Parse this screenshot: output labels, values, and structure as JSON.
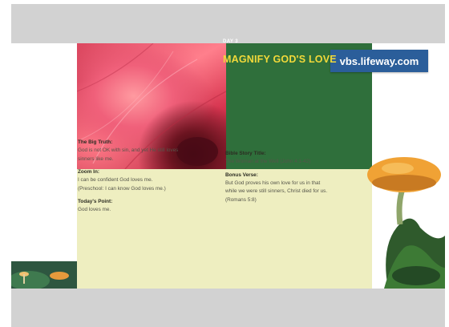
{
  "banner": {
    "url": "vbs.lifeway.com"
  },
  "slide": {
    "day_label": "DAY 3",
    "theme_title": "MAGNIFY GOD'S LOVE",
    "big_truth": {
      "heading": "The Big Truth:",
      "lines": [
        "God is not OK with sin, and yet He still loves",
        "sinners like me."
      ]
    },
    "zoom_in": {
      "heading": "Zoom In:",
      "lines": [
        "I can be confident God loves me.",
        "(Preschool: I can know God loves me.)"
      ]
    },
    "todays_point": {
      "heading": "Today's Point:",
      "lines": [
        "God loves me."
      ]
    },
    "bible_story": {
      "heading": "Bible Story Title:",
      "lines": [
        "The Woman at the Well (John 4:1-42)"
      ]
    },
    "bonus_verse": {
      "heading": "Bonus Verse:",
      "lines": [
        "But God proves his own love for us in that",
        "while we were still sinners, Christ died for us.",
        "(Romans 5:8)"
      ]
    }
  },
  "colors": {
    "green_panel": "#2f6f3b",
    "title_yellow": "#f2d93a",
    "content_bg": "#eeeec0",
    "badge_blue": "#2b5e9a",
    "letterbox_gray": "#d2d2d2"
  },
  "icons": [
    "flower-image",
    "mushroom-image"
  ]
}
